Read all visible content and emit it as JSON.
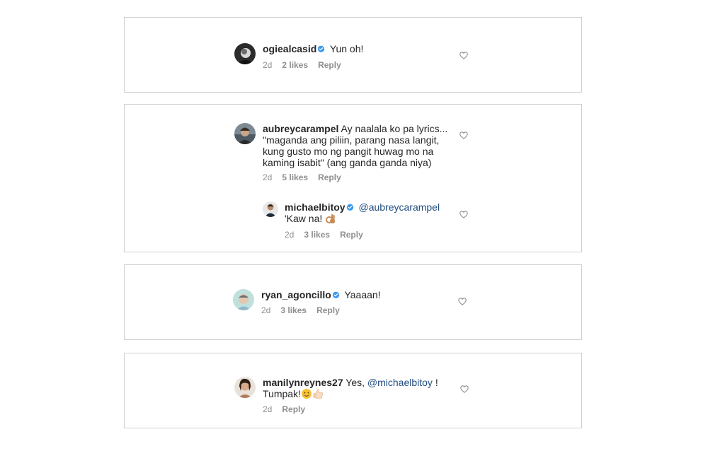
{
  "comments": [
    {
      "username": "ogiealcasid",
      "verified": true,
      "text": "Yun oh!",
      "time": "2d",
      "likes": "2 likes",
      "reply": "Reply"
    },
    {
      "username": "aubreycarampel",
      "verified": false,
      "text_lines": [
        "Ay naalala ko pa lyrics...",
        "\"maganda ang piliin, parang nasa langit,",
        "kung gusto mo ng pangit huwag mo na",
        "kaming isabit\" (ang ganda ganda niya)"
      ],
      "time": "2d",
      "likes": "5 likes",
      "reply": "Reply",
      "replies": [
        {
          "username": "michaelbitoy",
          "verified": true,
          "mention": "@aubreycarampel",
          "text": "'Kaw na!",
          "time": "2d",
          "likes": "3 likes",
          "reply": "Reply"
        }
      ]
    },
    {
      "username": "ryan_agoncillo",
      "verified": true,
      "text": "Yaaaan!",
      "time": "2d",
      "likes": "3 likes",
      "reply": "Reply"
    },
    {
      "username": "manilynreynes27",
      "verified": false,
      "text_before": "Yes,",
      "mention": "@michaelbitoy",
      "text_after": "!",
      "text_line2": "Tumpak!",
      "time": "2d",
      "reply": "Reply"
    }
  ],
  "icons": {
    "verified": "verified-badge-icon",
    "like": "heart-outline-icon",
    "ok_hand": "ok-hand-emoji",
    "smile": "smiling-face-emoji",
    "thumbs_up": "thumbs-up-emoji"
  },
  "colors": {
    "verified": "#3897f0",
    "mention": "#1f4c7e",
    "meta": "#8e8e8e",
    "border": "#cfcfcf"
  }
}
